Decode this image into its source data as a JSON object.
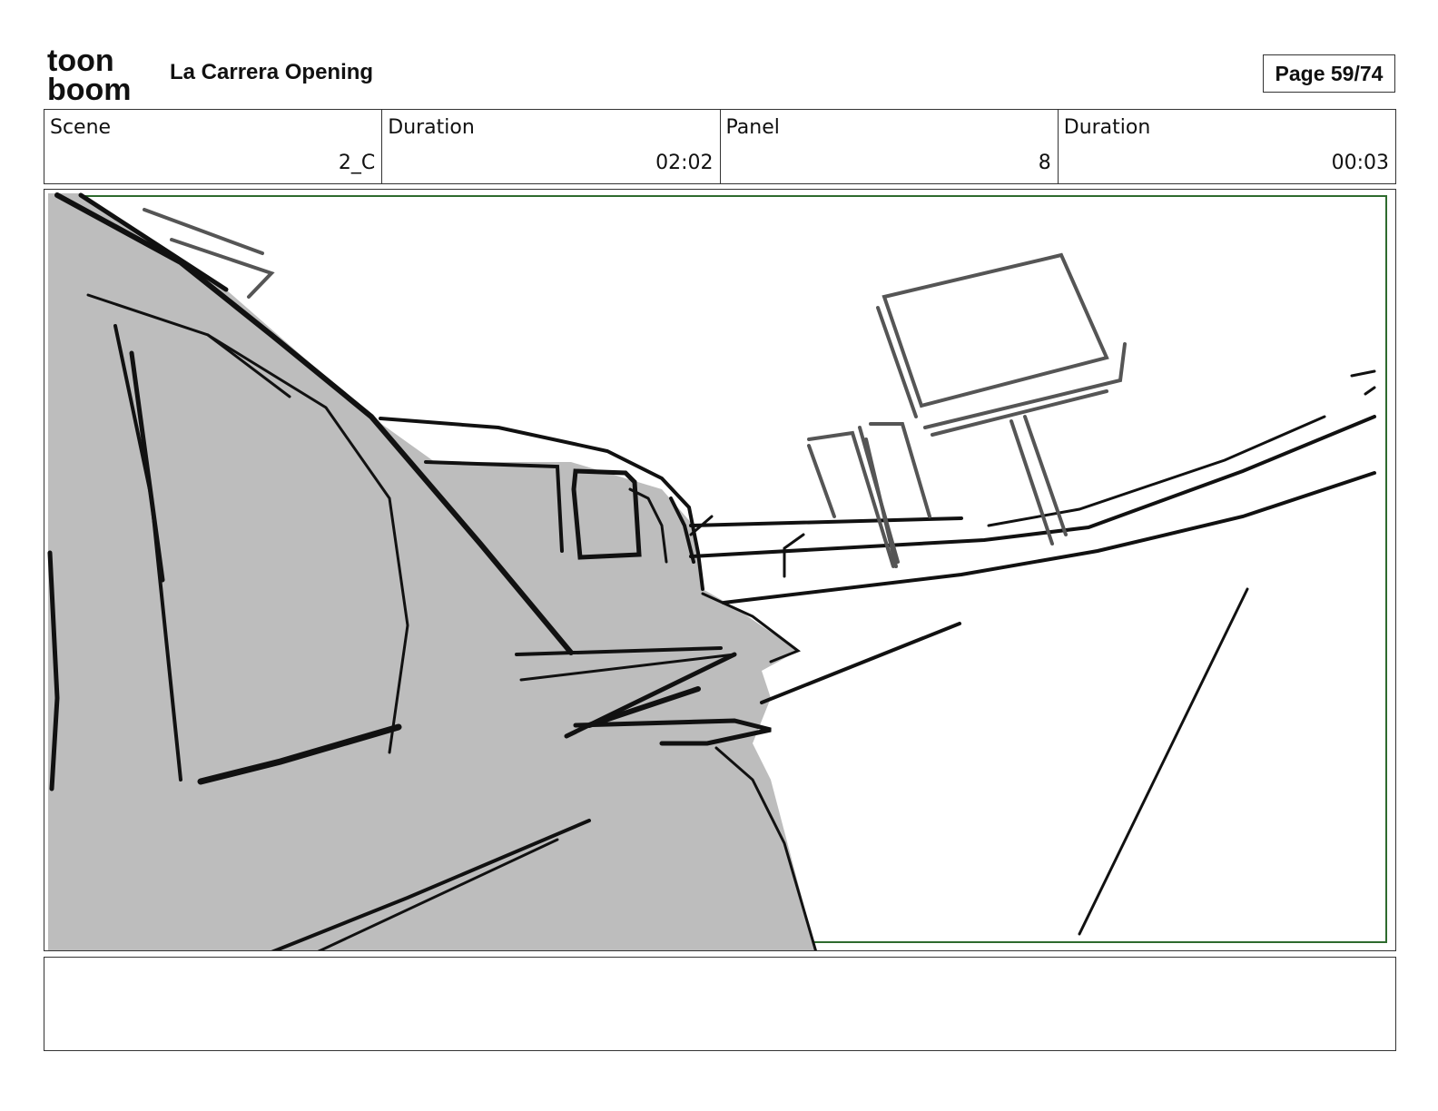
{
  "header": {
    "logo_top": "toon",
    "logo_bottom": "boom",
    "project_title": "La Carrera Opening",
    "page_indicator": "Page 59/74"
  },
  "info": {
    "scene_label": "Scene",
    "scene_value": "2_C",
    "scene_duration_label": "Duration",
    "scene_duration_value": "02:02",
    "panel_label": "Panel",
    "panel_value": "8",
    "panel_duration_label": "Duration",
    "panel_duration_value": "00:03"
  },
  "notes": {
    "text": ""
  }
}
